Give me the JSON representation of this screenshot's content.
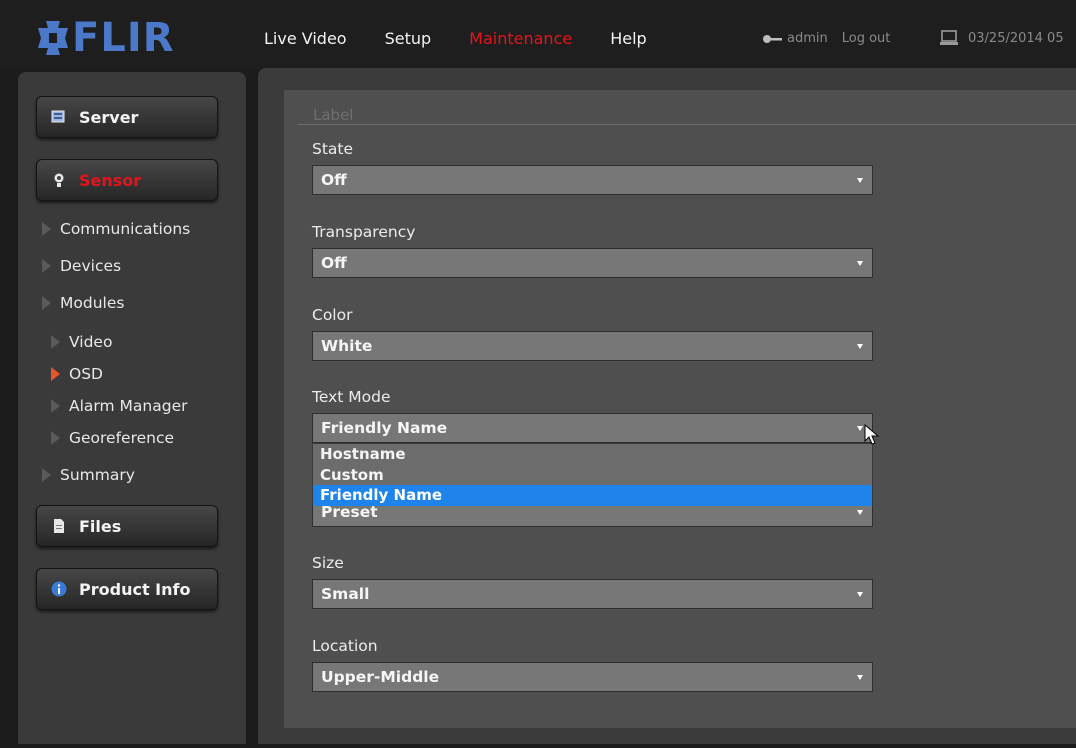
{
  "app": {
    "logo_text": "FLIR"
  },
  "nav": {
    "items": [
      {
        "label": "Live Video",
        "active": false
      },
      {
        "label": "Setup",
        "active": false
      },
      {
        "label": "Maintenance",
        "active": true
      },
      {
        "label": "Help",
        "active": false
      }
    ]
  },
  "user": {
    "name": "admin",
    "logout_label": "Log out",
    "datetime": "03/25/2014 05"
  },
  "sidebar": {
    "server_label": "Server",
    "sensor_label": "Sensor",
    "files_label": "Files",
    "product_info_label": "Product Info",
    "tree": {
      "communications": "Communications",
      "devices": "Devices",
      "modules": "Modules",
      "video": "Video",
      "osd": "OSD",
      "alarm_manager": "Alarm Manager",
      "georeference": "Georeference",
      "summary": "Summary"
    }
  },
  "form": {
    "section_label": "Label",
    "state": {
      "label": "State",
      "value": "Off"
    },
    "transparency": {
      "label": "Transparency",
      "value": "Off"
    },
    "color": {
      "label": "Color",
      "value": "White"
    },
    "text_mode": {
      "label": "Text Mode",
      "value": "Friendly Name",
      "options": [
        "Hostname",
        "Custom",
        "Friendly Name"
      ]
    },
    "hidden_field": {
      "value": "Preset"
    },
    "size": {
      "label": "Size",
      "value": "Small"
    },
    "location": {
      "label": "Location",
      "value": "Upper-Middle"
    }
  },
  "colors": {
    "accent_red": "#e3141c",
    "highlight_blue": "#1e83ea",
    "logo_blue": "#4b78c8"
  }
}
